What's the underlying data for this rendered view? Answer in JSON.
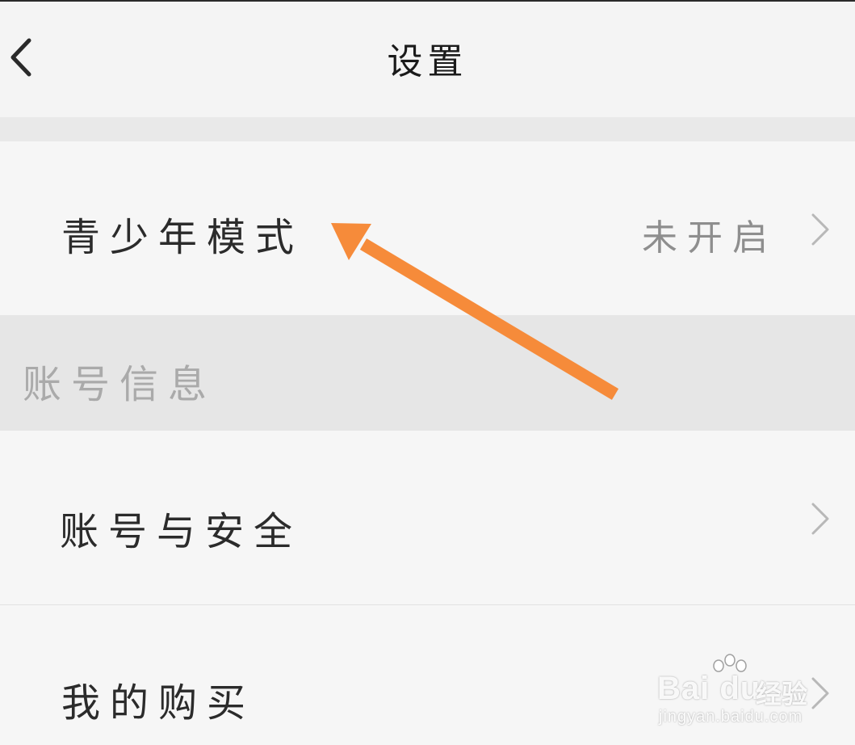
{
  "header": {
    "title": "设置",
    "back_icon": "chevron-left-icon"
  },
  "rows": [
    {
      "label": "青少年模式",
      "value": "未开启",
      "icon": "chevron-right-icon"
    },
    {
      "label": "账号与安全",
      "icon": "chevron-right-icon"
    },
    {
      "label": "我的购买",
      "icon": "chevron-right-icon"
    }
  ],
  "section": {
    "title": "账号信息"
  },
  "annotation": {
    "color": "#f68b3a",
    "icon": "arrow-annotation"
  },
  "watermark": {
    "brand": "Bai du",
    "cn": "经验",
    "url": "jingyan.baidu.com"
  }
}
